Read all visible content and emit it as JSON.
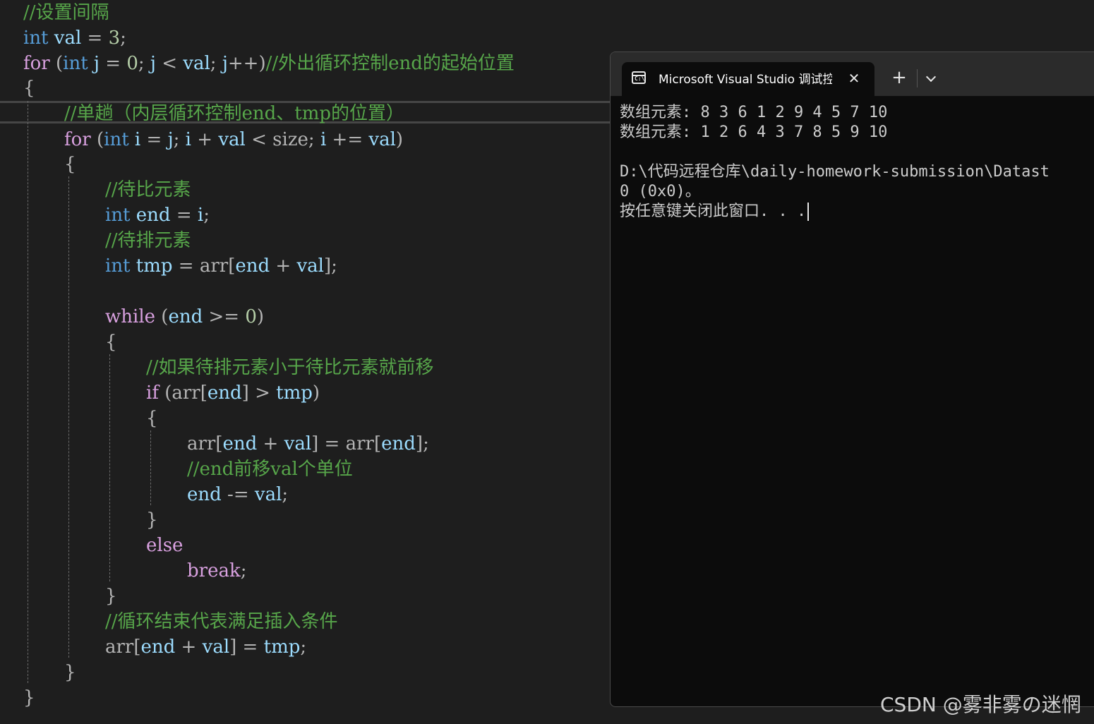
{
  "editor": {
    "lines": [
      {
        "tokens": [
          {
            "t": "//设置间隔",
            "c": "cmt"
          }
        ]
      },
      {
        "tokens": [
          {
            "t": "int",
            "c": "kw"
          },
          {
            "t": " "
          },
          {
            "t": "val",
            "c": "var"
          },
          {
            "t": " = ",
            "c": "op"
          },
          {
            "t": "3",
            "c": "num"
          },
          {
            "t": ";",
            "c": "pn"
          }
        ]
      },
      {
        "tokens": [
          {
            "t": "for",
            "c": "ctl"
          },
          {
            "t": " (",
            "c": "pn"
          },
          {
            "t": "int",
            "c": "kw"
          },
          {
            "t": " "
          },
          {
            "t": "j",
            "c": "var"
          },
          {
            "t": " = ",
            "c": "op"
          },
          {
            "t": "0",
            "c": "num"
          },
          {
            "t": "; ",
            "c": "pn"
          },
          {
            "t": "j",
            "c": "var"
          },
          {
            "t": " < ",
            "c": "op"
          },
          {
            "t": "val",
            "c": "var"
          },
          {
            "t": "; ",
            "c": "pn"
          },
          {
            "t": "j",
            "c": "var"
          },
          {
            "t": "++)",
            "c": "pn"
          },
          {
            "t": "//外出循环控制end的起始位置",
            "c": "cmt"
          }
        ]
      },
      {
        "tokens": [
          {
            "t": "{",
            "c": "pn"
          }
        ]
      },
      {
        "tokens": [
          {
            "t": "//单趟（内层循环控制end、tmp的位置）",
            "c": "cmt"
          }
        ]
      },
      {
        "tokens": [
          {
            "t": "for",
            "c": "ctl"
          },
          {
            "t": " (",
            "c": "pn"
          },
          {
            "t": "int",
            "c": "kw"
          },
          {
            "t": " "
          },
          {
            "t": "i",
            "c": "var"
          },
          {
            "t": " = ",
            "c": "op"
          },
          {
            "t": "j",
            "c": "var"
          },
          {
            "t": "; ",
            "c": "pn"
          },
          {
            "t": "i",
            "c": "var"
          },
          {
            "t": " + ",
            "c": "op"
          },
          {
            "t": "val",
            "c": "var"
          },
          {
            "t": " < ",
            "c": "op"
          },
          {
            "t": "size",
            "c": "pn"
          },
          {
            "t": "; ",
            "c": "pn"
          },
          {
            "t": "i",
            "c": "var"
          },
          {
            "t": " += ",
            "c": "op"
          },
          {
            "t": "val",
            "c": "var"
          },
          {
            "t": ")",
            "c": "pn"
          }
        ]
      },
      {
        "tokens": [
          {
            "t": "{",
            "c": "pn"
          }
        ]
      },
      {
        "tokens": [
          {
            "t": "//待比元素",
            "c": "cmt"
          }
        ]
      },
      {
        "tokens": [
          {
            "t": "int",
            "c": "kw"
          },
          {
            "t": " "
          },
          {
            "t": "end",
            "c": "var"
          },
          {
            "t": " = ",
            "c": "op"
          },
          {
            "t": "i",
            "c": "var"
          },
          {
            "t": ";",
            "c": "pn"
          }
        ]
      },
      {
        "tokens": [
          {
            "t": "//待排元素",
            "c": "cmt"
          }
        ]
      },
      {
        "tokens": [
          {
            "t": "int",
            "c": "kw"
          },
          {
            "t": " "
          },
          {
            "t": "tmp",
            "c": "var"
          },
          {
            "t": " = ",
            "c": "op"
          },
          {
            "t": "arr",
            "c": "pn"
          },
          {
            "t": "[",
            "c": "pn"
          },
          {
            "t": "end",
            "c": "var"
          },
          {
            "t": " + ",
            "c": "op"
          },
          {
            "t": "val",
            "c": "var"
          },
          {
            "t": "];",
            "c": "pn"
          }
        ]
      },
      {
        "tokens": []
      },
      {
        "tokens": [
          {
            "t": "while",
            "c": "ctl"
          },
          {
            "t": " (",
            "c": "pn"
          },
          {
            "t": "end",
            "c": "var"
          },
          {
            "t": " >= ",
            "c": "op"
          },
          {
            "t": "0",
            "c": "num"
          },
          {
            "t": ")",
            "c": "pn"
          }
        ]
      },
      {
        "tokens": [
          {
            "t": "{",
            "c": "pn"
          }
        ]
      },
      {
        "tokens": [
          {
            "t": "//如果待排元素小于待比元素就前移",
            "c": "cmt"
          }
        ]
      },
      {
        "tokens": [
          {
            "t": "if",
            "c": "ctl"
          },
          {
            "t": " (",
            "c": "pn"
          },
          {
            "t": "arr",
            "c": "pn"
          },
          {
            "t": "[",
            "c": "pn"
          },
          {
            "t": "end",
            "c": "var"
          },
          {
            "t": "]",
            "c": "pn"
          },
          {
            "t": " > ",
            "c": "op"
          },
          {
            "t": "tmp",
            "c": "var"
          },
          {
            "t": ")",
            "c": "pn"
          }
        ]
      },
      {
        "tokens": [
          {
            "t": "{",
            "c": "pn"
          }
        ]
      },
      {
        "tokens": [
          {
            "t": "arr",
            "c": "pn"
          },
          {
            "t": "[",
            "c": "pn"
          },
          {
            "t": "end",
            "c": "var"
          },
          {
            "t": " + ",
            "c": "op"
          },
          {
            "t": "val",
            "c": "var"
          },
          {
            "t": "]",
            "c": "pn"
          },
          {
            "t": " = ",
            "c": "op"
          },
          {
            "t": "arr",
            "c": "pn"
          },
          {
            "t": "[",
            "c": "pn"
          },
          {
            "t": "end",
            "c": "var"
          },
          {
            "t": "];",
            "c": "pn"
          }
        ]
      },
      {
        "tokens": [
          {
            "t": "//end前移val个单位",
            "c": "cmt"
          }
        ]
      },
      {
        "tokens": [
          {
            "t": "end",
            "c": "var"
          },
          {
            "t": " -= ",
            "c": "op"
          },
          {
            "t": "val",
            "c": "var"
          },
          {
            "t": ";",
            "c": "pn"
          }
        ]
      },
      {
        "tokens": [
          {
            "t": "}",
            "c": "pn"
          }
        ]
      },
      {
        "tokens": [
          {
            "t": "else",
            "c": "ctl"
          }
        ]
      },
      {
        "tokens": [
          {
            "t": "break",
            "c": "ctl"
          },
          {
            "t": ";",
            "c": "pn"
          }
        ]
      },
      {
        "tokens": [
          {
            "t": "}",
            "c": "pn"
          }
        ]
      },
      {
        "tokens": [
          {
            "t": "//循环结束代表满足插入条件",
            "c": "cmt"
          }
        ]
      },
      {
        "tokens": [
          {
            "t": "arr",
            "c": "pn"
          },
          {
            "t": "[",
            "c": "pn"
          },
          {
            "t": "end",
            "c": "var"
          },
          {
            "t": " + ",
            "c": "op"
          },
          {
            "t": "val",
            "c": "var"
          },
          {
            "t": "]",
            "c": "pn"
          },
          {
            "t": " = ",
            "c": "op"
          },
          {
            "t": "tmp",
            "c": "var"
          },
          {
            "t": ";",
            "c": "pn"
          }
        ]
      },
      {
        "tokens": [
          {
            "t": "}",
            "c": "pn"
          }
        ]
      },
      {
        "tokens": [
          {
            "t": "}",
            "c": "pn"
          }
        ]
      }
    ]
  },
  "terminal": {
    "tab_title": "Microsoft Visual Studio 调试控制台",
    "tab_icon_text": "C:\\",
    "close_glyph": "✕",
    "new_tab_glyph": "+",
    "lines": [
      "数组元素: 8 3 6 1 2 9 4 5 7 10",
      "数组元素: 1 2 6 4 3 7 8 5 9 10",
      "",
      "D:\\代码远程仓库\\daily-homework-submission\\Datast",
      "0 (0x0)。",
      "按任意键关闭此窗口. . ."
    ]
  },
  "watermark": "CSDN @雾非雾の迷惘",
  "colors": {
    "editor_bg": "#1e1e1e",
    "comment": "#57a64a",
    "keyword": "#569cd6",
    "control": "#d8a0df",
    "variable": "#9cdcfe",
    "number": "#b5cea8",
    "terminal_bg": "#0c0c0c"
  }
}
